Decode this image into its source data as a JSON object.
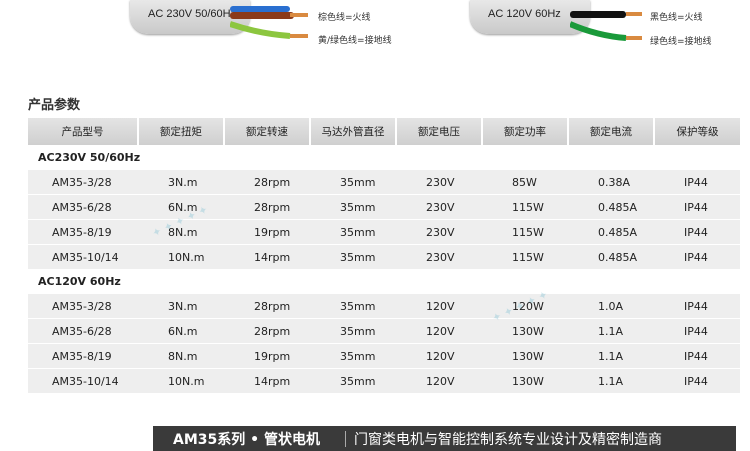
{
  "wiring": {
    "left": {
      "label": "AC 230V 50/60Hz",
      "wires": [
        "棕色线=火线",
        "黄/绿色线=接地线"
      ]
    },
    "right": {
      "label": "AC 120V 60Hz",
      "wires": [
        "黑色线=火线",
        "绿色线=接地线"
      ]
    }
  },
  "section_title": "产品参数",
  "table": {
    "headers": [
      "产品型号",
      "额定扭矩",
      "额定转速",
      "马达外管直径",
      "额定电压",
      "额定功率",
      "额定电流",
      "保护等级"
    ],
    "groups": [
      {
        "label": "AC230V 50/60Hz",
        "rows": [
          [
            "AM35-3/28",
            "3N.m",
            "28rpm",
            "35mm",
            "230V",
            "85W",
            "0.38A",
            "IP44"
          ],
          [
            "AM35-6/28",
            "6N.m",
            "28rpm",
            "35mm",
            "230V",
            "115W",
            "0.485A",
            "IP44"
          ],
          [
            "AM35-8/19",
            "8N.m",
            "19rpm",
            "35mm",
            "230V",
            "115W",
            "0.485A",
            "IP44"
          ],
          [
            "AM35-10/14",
            "10N.m",
            "14rpm",
            "35mm",
            "230V",
            "115W",
            "0.485A",
            "IP44"
          ]
        ]
      },
      {
        "label": "AC120V  60Hz",
        "rows": [
          [
            "AM35-3/28",
            "3N.m",
            "28rpm",
            "35mm",
            "120V",
            "120W",
            "1.0A",
            "IP44"
          ],
          [
            "AM35-6/28",
            "6N.m",
            "28rpm",
            "35mm",
            "120V",
            "130W",
            "1.1A",
            "IP44"
          ],
          [
            "AM35-8/19",
            "8N.m",
            "19rpm",
            "35mm",
            "120V",
            "130W",
            "1.1A",
            "IP44"
          ],
          [
            "AM35-10/14",
            "10N.m",
            "14rpm",
            "35mm",
            "120V",
            "130W",
            "1.1A",
            "IP44"
          ]
        ]
      }
    ]
  },
  "footer": {
    "series": "AM35系列 • 管状电机",
    "slogan": "门窗类电机与智能控制系统专业设计及精密制造商"
  },
  "colors": {
    "brown_wire": "#8b3a1a",
    "blue_wire": "#2a6fd0",
    "yellow_green_wire": "#8cc63f",
    "black_wire": "#111111",
    "green_wire": "#1a9a3a",
    "footer_bg": "#3a3a3a"
  }
}
